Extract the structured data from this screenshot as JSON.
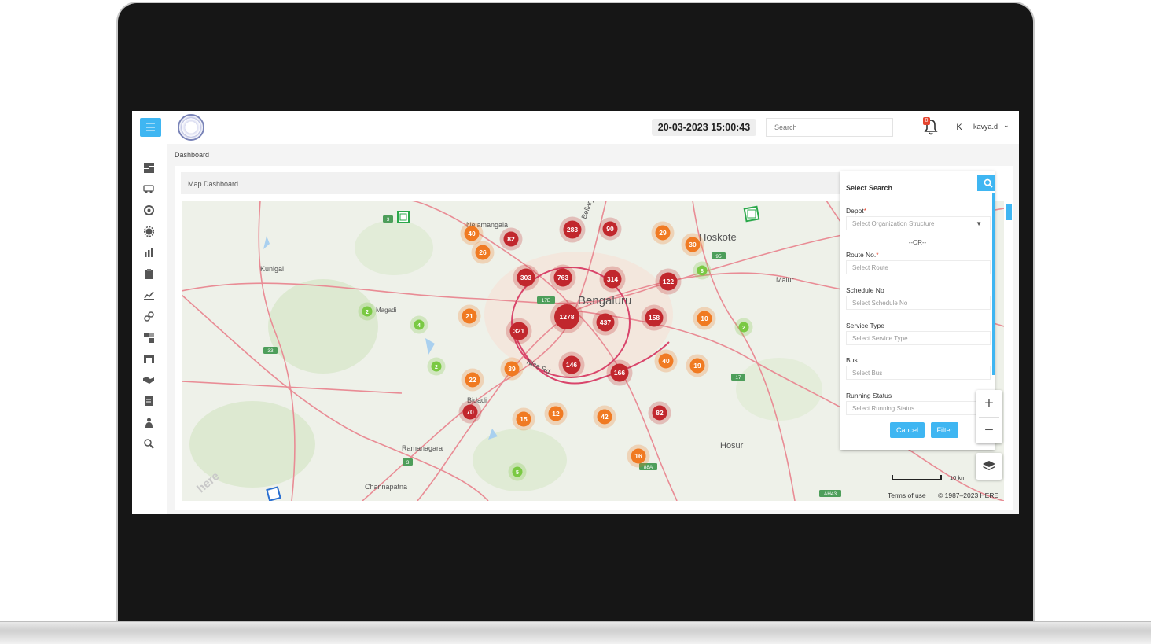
{
  "topbar": {
    "datetime": "20-03-2023 15:00:43",
    "search_placeholder": "Search",
    "notification_count": "0",
    "avatar_initial": "K",
    "username": "kavya.d"
  },
  "breadcrumb": "Dashboard",
  "card_title": "Map Dashboard",
  "sidebar_icons": [
    "dashboard-icon",
    "bus-icon",
    "support-icon",
    "settings-icon",
    "bar-chart-icon",
    "clipboard-icon",
    "line-chart-icon",
    "link-icon",
    "puzzle-icon",
    "depot-icon",
    "handshake-icon",
    "document-icon",
    "person-icon",
    "zoom-search-icon"
  ],
  "panel": {
    "title": "Select Search",
    "fields": [
      {
        "label": "Depot",
        "required": true,
        "placeholder": "Select Organization Structure",
        "dropdown": true
      },
      {
        "label": "Route No.",
        "required": true,
        "placeholder": "Select Route",
        "dropdown": false
      },
      {
        "label": "Schedule No",
        "required": false,
        "placeholder": "Select Schedule No",
        "dropdown": false
      },
      {
        "label": "Service Type",
        "required": false,
        "placeholder": "Select Service Type",
        "dropdown": false
      },
      {
        "label": "Bus",
        "required": false,
        "placeholder": "Select Bus",
        "dropdown": false
      },
      {
        "label": "Running Status",
        "required": false,
        "placeholder": "Select Running Status",
        "dropdown": false
      }
    ],
    "or_text": "--OR--",
    "required_mark": "*",
    "cancel_label": "Cancel",
    "filter_label": "Filter"
  },
  "map": {
    "place_labels": [
      "Nelamangala",
      "Bellary",
      "Hoskote",
      "Kunigal",
      "Malur",
      "Bengaluru",
      "Magadi",
      "Nice Rd.",
      "Bidadi",
      "Ramanagara",
      "Hosur",
      "Channapatna"
    ],
    "road_shields": [
      "3",
      "17E",
      "95",
      "33",
      "17",
      "3",
      "88A",
      "AH43"
    ],
    "clusters": [
      {
        "count": "40",
        "level": "orange"
      },
      {
        "count": "82",
        "level": "red"
      },
      {
        "count": "26",
        "level": "orange"
      },
      {
        "count": "283",
        "level": "red"
      },
      {
        "count": "90",
        "level": "red"
      },
      {
        "count": "29",
        "level": "orange"
      },
      {
        "count": "30",
        "level": "orange"
      },
      {
        "count": "8",
        "level": "green"
      },
      {
        "count": "303",
        "level": "red"
      },
      {
        "count": "763",
        "level": "red"
      },
      {
        "count": "314",
        "level": "red"
      },
      {
        "count": "122",
        "level": "red"
      },
      {
        "count": "2",
        "level": "green"
      },
      {
        "count": "4",
        "level": "green"
      },
      {
        "count": "21",
        "level": "orange"
      },
      {
        "count": "1278",
        "level": "red"
      },
      {
        "count": "437",
        "level": "red"
      },
      {
        "count": "158",
        "level": "red"
      },
      {
        "count": "10",
        "level": "orange"
      },
      {
        "count": "2",
        "level": "green"
      },
      {
        "count": "321",
        "level": "red"
      },
      {
        "count": "2",
        "level": "green"
      },
      {
        "count": "39",
        "level": "orange"
      },
      {
        "count": "146",
        "level": "red"
      },
      {
        "count": "166",
        "level": "red"
      },
      {
        "count": "40",
        "level": "orange"
      },
      {
        "count": "19",
        "level": "orange"
      },
      {
        "count": "22",
        "level": "orange"
      },
      {
        "count": "70",
        "level": "red"
      },
      {
        "count": "15",
        "level": "orange"
      },
      {
        "count": "12",
        "level": "orange"
      },
      {
        "count": "42",
        "level": "orange"
      },
      {
        "count": "82",
        "level": "red"
      },
      {
        "count": "16",
        "level": "orange"
      },
      {
        "count": "5",
        "level": "green"
      }
    ],
    "watermark": "here",
    "scale_label": "10 km",
    "terms_label": "Terms of use",
    "copyright": "© 1987–2023 HERE"
  },
  "colors": {
    "accent": "#3fb6f2",
    "cluster_red": "#c1272d",
    "cluster_orange": "#f07a22",
    "cluster_green": "#7ac943",
    "road": "#e07a86"
  }
}
